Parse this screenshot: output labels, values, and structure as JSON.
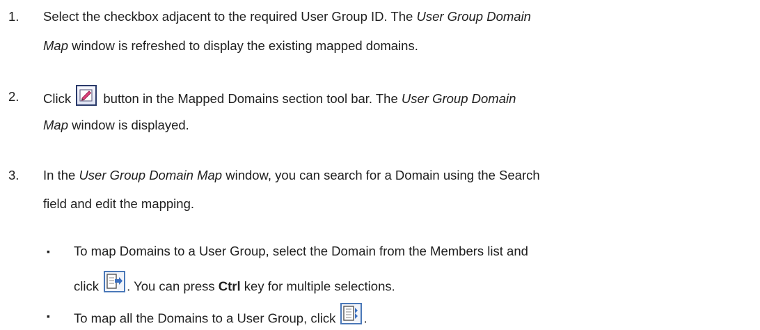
{
  "steps": [
    {
      "number": "1.",
      "line1": {
        "pre": "Select the checkbox adjacent to the required User Group ID. The ",
        "em": "User Group Domain"
      },
      "line2": {
        "em": "Map",
        "post": " window is refreshed to display the existing mapped domains."
      }
    },
    {
      "number": "2.",
      "line1": {
        "pre": "Click ",
        "icon": "edit-icon",
        "mid": " button in the Mapped Domains section tool bar. The ",
        "em": "User Group Domain"
      },
      "line2": {
        "em": "Map",
        "post": " window is  displayed."
      }
    },
    {
      "number": "3.",
      "line1": {
        "pre": "In the ",
        "em": "User Group Domain Map",
        "post": " window, you can search for a Domain using the Search"
      },
      "line2": {
        "text": "field and edit the mapping."
      }
    }
  ],
  "bullets": [
    {
      "symbol": "▪",
      "line1": "To map Domains to a User Group, select the Domain from the Members list and",
      "line2": {
        "pre": "click ",
        "icon": "map-selected-icon",
        "mid": ". You can press ",
        "bold": "Ctrl",
        "post": " key for multiple selections."
      }
    },
    {
      "symbol": "▪",
      "line1": {
        "pre": "To map all the Domains to a User Group, click ",
        "icon": "map-all-icon",
        "post": "."
      }
    }
  ]
}
